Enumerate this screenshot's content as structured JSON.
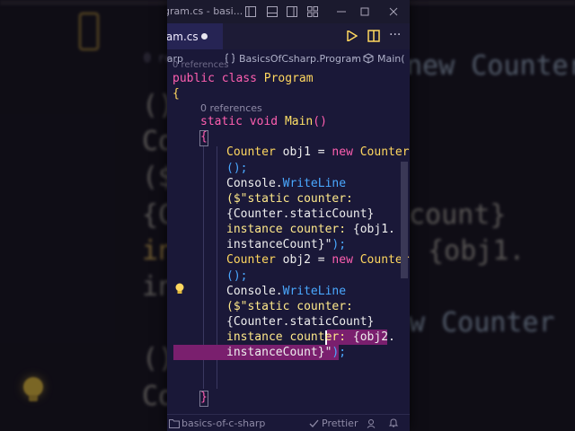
{
  "window": {
    "title": "Program.cs - basics-of-c-sharp",
    "title_visible": "gram.cs - basi..."
  },
  "tab": {
    "label": "ram.cs",
    "unsaved": true
  },
  "breadcrumb": {
    "items": [
      "BasicsOfCsharp",
      "BasicsOfCsharp.Program",
      "Main("
    ]
  },
  "codelens": {
    "top": "0 references",
    "main": "0 references"
  },
  "code": {
    "class_decl": [
      "public",
      " ",
      "class",
      " ",
      "Program"
    ],
    "open_brace": "{",
    "main_decl": [
      "static",
      " ",
      "void",
      " ",
      "Main",
      "()"
    ],
    "main_open": "{",
    "l1": [
      "Counter",
      " obj1 = ",
      "new",
      " Counter"
    ],
    "l2": "();",
    "l3": [
      "Console",
      ".",
      "WriteLine"
    ],
    "l4": "($\"static counter: ",
    "l5": "{Counter.staticCount}",
    "l6": [
      "instance counter: ",
      "{obj1."
    ],
    "l7": [
      "instanceCount}\"",
      ");"
    ],
    "l8": [
      "Counter",
      " obj2 = ",
      "new",
      " Counter"
    ],
    "l9": "();",
    "l10": [
      "Console",
      ".",
      "WriteLine"
    ],
    "l11": "($\"static counter: ",
    "l12": "{Counter.staticCount}",
    "l13": [
      "instance counter: ",
      "{obj2."
    ],
    "l14": [
      "instanceCount}\"",
      ");"
    ],
    "main_close": "}"
  },
  "statusbar": {
    "branch": "basics-of-c-sharp",
    "formatter": "Prettier"
  },
  "background": {
    "lines": [
      {
        "text": "0 references",
        "small": true
      },
      {
        "text": "new Counter"
      },
      {
        "text": "()"
      },
      {
        "text": "Counter"
      },
      {
        "text": "($"
      },
      {
        "text": "{Co"
      },
      {
        "text": "count}"
      },
      {
        "text": "in"
      },
      {
        "text": "{obj1."
      },
      {
        "text": "in"
      },
      {
        "text": "w Counter"
      },
      {
        "text": "()"
      },
      {
        "text": "Co"
      }
    ]
  },
  "colors": {
    "keyword": "#ff5fb0",
    "type": "#ffd75f",
    "method": "#4aa8ff",
    "selection": "#7a1f6e",
    "editor_bg": "#1a1838"
  }
}
